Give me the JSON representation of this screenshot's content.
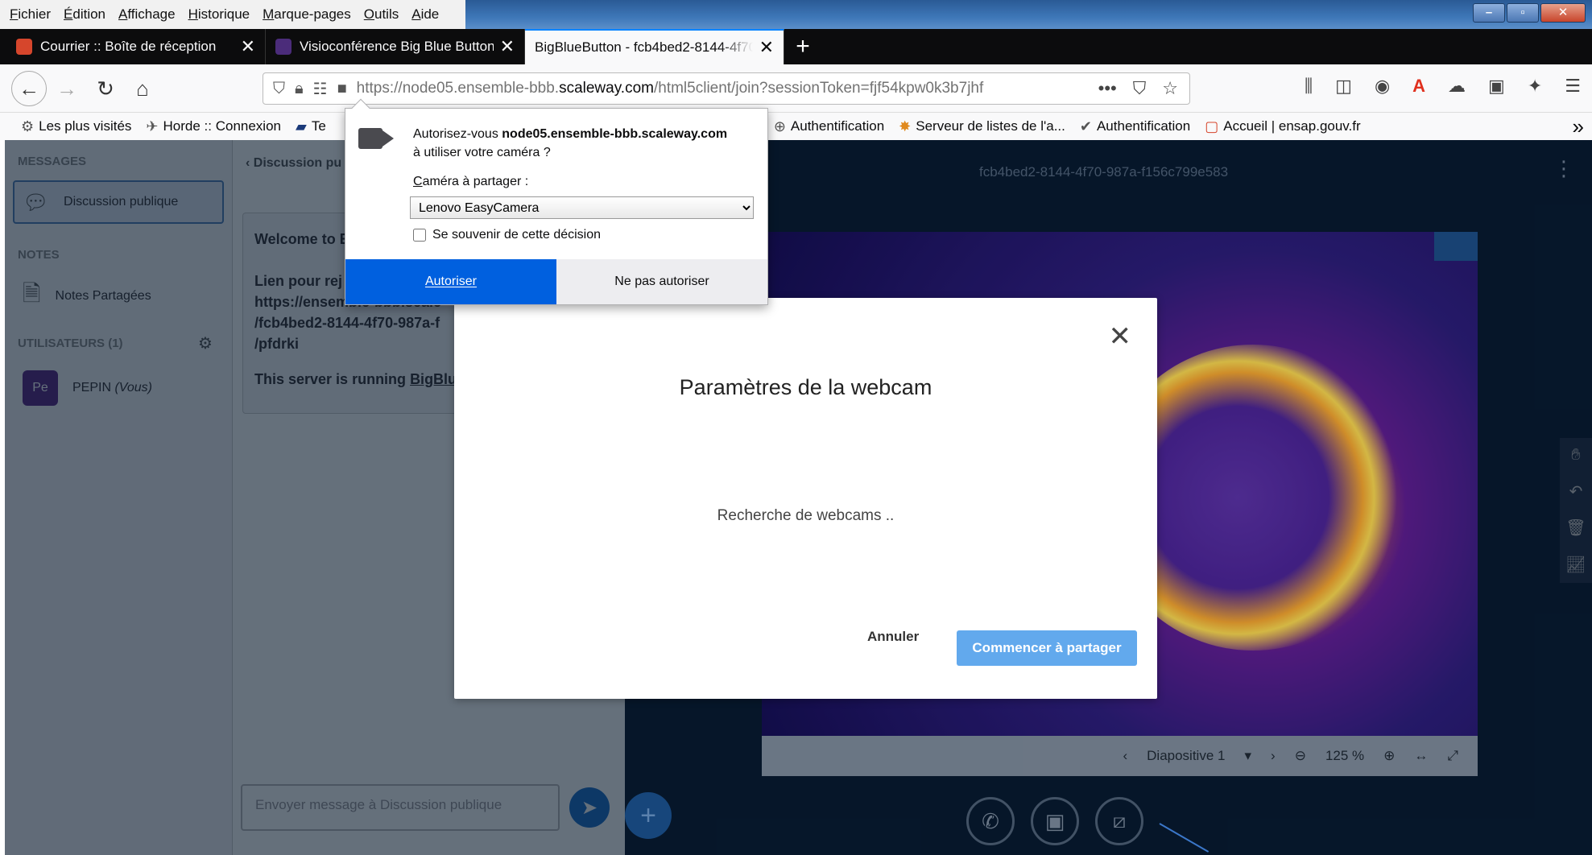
{
  "menubar": {
    "items": [
      "Fichier",
      "Édition",
      "Affichage",
      "Historique",
      "Marque-pages",
      "Outils",
      "Aide"
    ]
  },
  "tabs": [
    {
      "title": "Courrier :: Boîte de réception",
      "favicon_color": "#d6462c"
    },
    {
      "title": "Visioconférence Big Blue Button",
      "favicon_color": "#4b2c7a"
    },
    {
      "title": "BigBlueButton - fcb4bed2-8144-4f70",
      "favicon_color": "#ffffff"
    }
  ],
  "navbar": {
    "url_host_prefix": "https://node05.ensemble-bbb.",
    "url_host_main": "scaleway.com",
    "url_path": "/html5client/join?sessionToken=fjf54kpw0k3b7jhf"
  },
  "bookmarks": [
    {
      "label": "Les plus visités",
      "icon": "gear-icon"
    },
    {
      "label": "Horde :: Connexion",
      "icon": "horde-icon"
    },
    {
      "label": "Te",
      "icon": "bookmark-icon"
    },
    {
      "label": "Authentification",
      "icon": "globe-icon"
    },
    {
      "label": "Serveur de listes de l'a...",
      "icon": "star-icon"
    },
    {
      "label": "Authentification",
      "icon": "check-icon"
    },
    {
      "label": "Accueil | ensap.gouv.fr",
      "icon": "page-icon"
    }
  ],
  "userlist": {
    "messages_header": "MESSAGES",
    "public_chat": "Discussion publique",
    "notes_header": "NOTES",
    "shared_notes": "Notes Partagées",
    "users_header": "UTILISATEURS (1)",
    "user_initials": "Pe",
    "user_name": "PEPIN",
    "user_self": "(Vous)"
  },
  "chat": {
    "back_label": "Discussion pu",
    "welcome": "Welcome to E",
    "link_intro": "Lien pour rej",
    "link_1": "https://ensemble-bbb.scale",
    "link_2": "/fcb4bed2-8144-4f70-987a-f",
    "link_3": "/pfdrki",
    "server_text": "This server is running ",
    "server_link": "BigBlu",
    "input_placeholder": "Envoyer message à Discussion publique"
  },
  "presentation": {
    "meeting_id": "fcb4bed2-8144-4f70-987a-f156c799e583",
    "slide_label": "Diapositive 1",
    "zoom": "125 %"
  },
  "permission": {
    "question_prefix": "Autorisez-vous ",
    "host": "node05.ensemble-bbb.scaleway.com",
    "question_suffix": "à utiliser votre caméra ?",
    "camera_label": "Caméra à partager :",
    "camera_selected": "Lenovo EasyCamera",
    "remember_label": "Se souvenir de cette décision",
    "allow_label": "Autoriser",
    "deny_label": "Ne pas autoriser"
  },
  "modal": {
    "title": "Paramètres de la webcam",
    "status": "Recherche de webcams ..",
    "cancel_label": "Annuler",
    "share_label": "Commencer à partager"
  },
  "colors": {
    "allow_blue": "#0060df",
    "share_blue": "#62a9ed",
    "app_bg": "#06172a"
  }
}
